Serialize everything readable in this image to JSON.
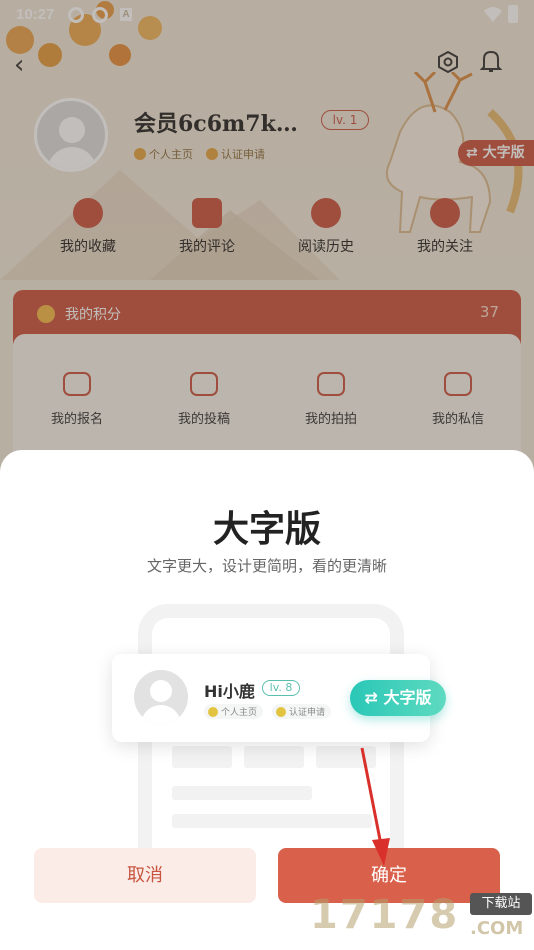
{
  "status": {
    "time": "10:27",
    "a_icon": "A"
  },
  "profile": {
    "username": "会员6c6m7k…",
    "level": "lv. 1",
    "tag_home": "个人主页",
    "tag_verify": "认证申请",
    "big_font_button": "⇄ 大字版"
  },
  "quick_actions": [
    {
      "label": "我的收藏",
      "icon": "star-icon"
    },
    {
      "label": "我的评论",
      "icon": "comment-icon"
    },
    {
      "label": "阅读历史",
      "icon": "clock-icon"
    },
    {
      "label": "我的关注",
      "icon": "heart-icon"
    }
  ],
  "points": {
    "label": "我的积分",
    "value": "37"
  },
  "activities": [
    {
      "label": "我的报名",
      "icon": "signup-icon"
    },
    {
      "label": "我的投稿",
      "icon": "edit-icon"
    },
    {
      "label": "我的拍拍",
      "icon": "video-icon"
    },
    {
      "label": "我的私信",
      "icon": "message-icon"
    }
  ],
  "dialog": {
    "title": "大字版",
    "subtitle": "文字更大，设计更简明，看的更清晰",
    "preview": {
      "name": "Hi小鹿",
      "level": "lv. 8",
      "tag_home": "个人主页",
      "tag_verify": "认证申请",
      "switch_label": "⇄ 大字版"
    },
    "cancel_label": "取消",
    "confirm_label": "确定"
  },
  "watermark": {
    "digits": "17178",
    "badge": "下载站",
    "domain": ".COM"
  },
  "colors": {
    "accent": "#c9543f",
    "confirm": "#d9604b",
    "teal": "#2ac7b7"
  }
}
